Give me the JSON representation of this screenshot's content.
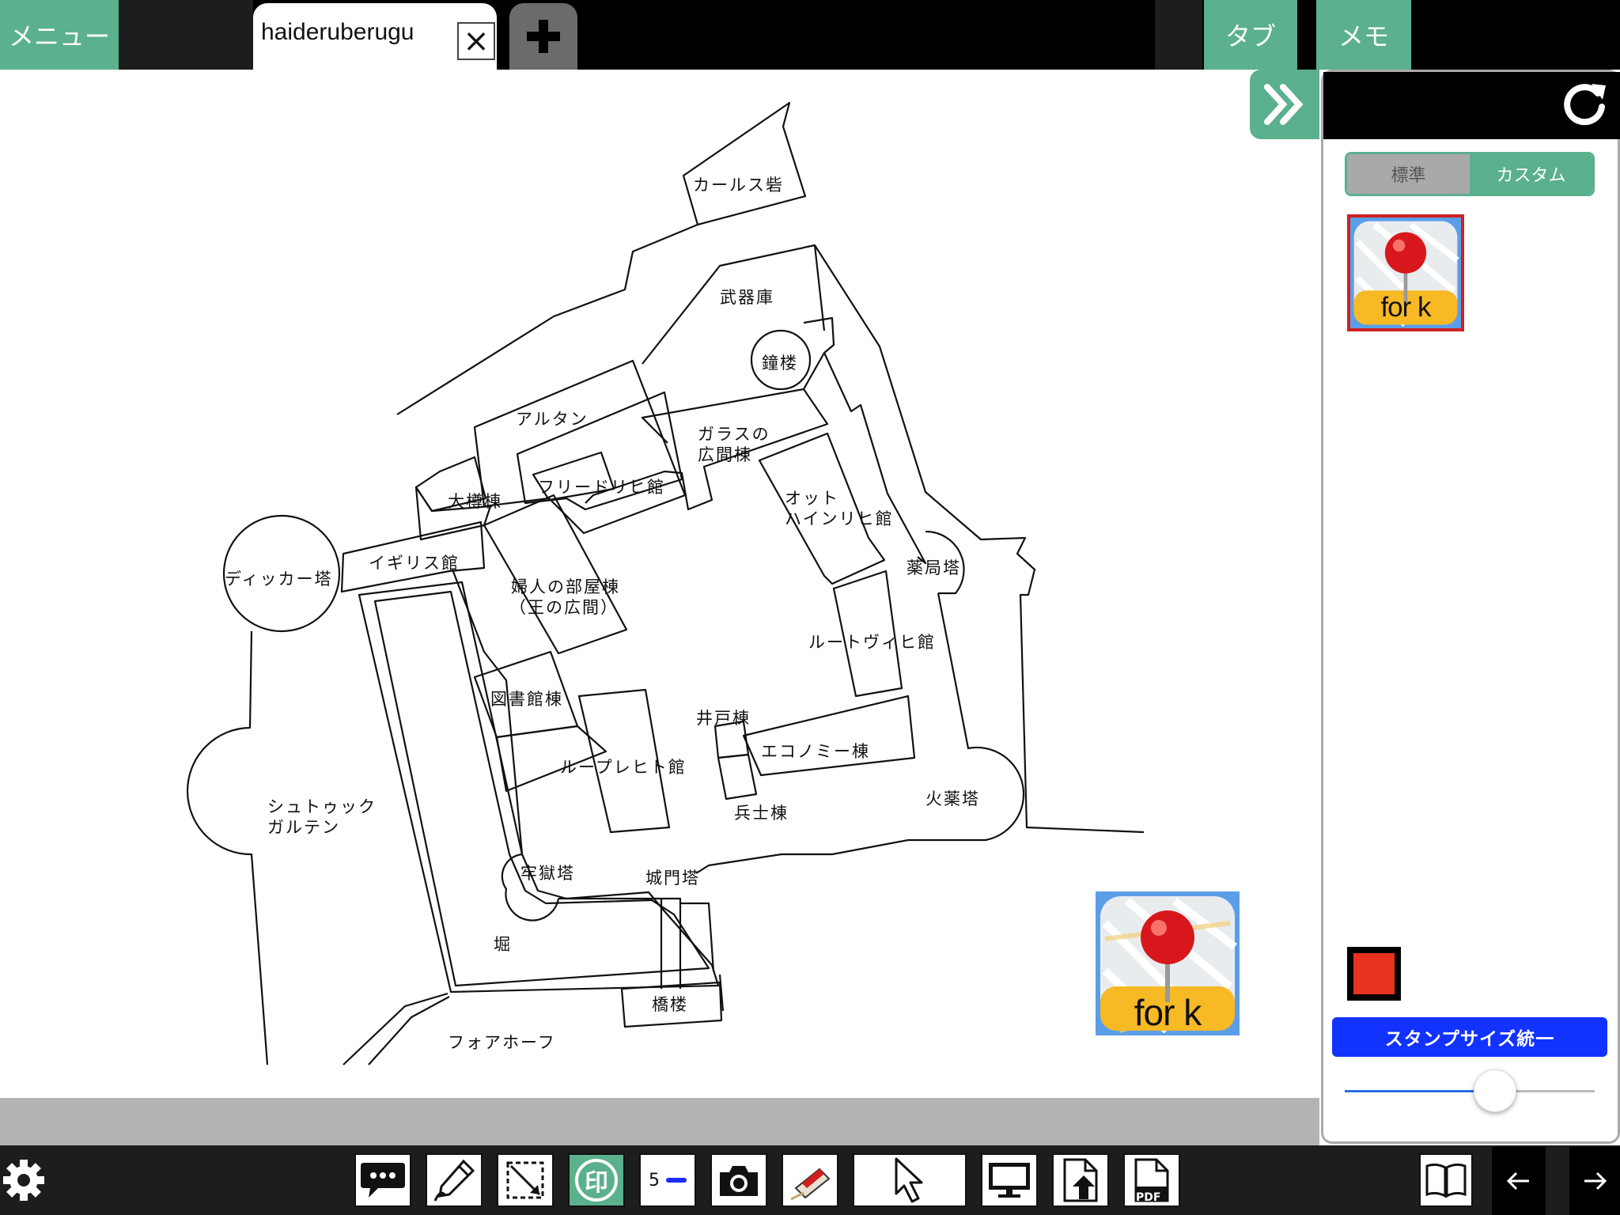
{
  "header": {
    "menu_label": "メニュー",
    "doc_tab_label": "haideruberugu",
    "close_tab_symbol": "×",
    "tabs_label": "タブ",
    "memo_label": "メモ"
  },
  "map": {
    "labels": {
      "carls": "カールス砦",
      "armory": "武器庫",
      "bell": "鐘楼",
      "arutan": "アルタン",
      "glass1": "ガラスの",
      "glass2": "広間棟",
      "friedrich": "フリードリヒ館",
      "barrel": "大樽棟",
      "otto1": "オット",
      "otto2": "ハインリヒ館",
      "dicker": "ディッカー塔",
      "english": "イギリス館",
      "ladies1": "婦人の部屋棟",
      "ladies2": "（王の広間）",
      "apothecary": "薬局塔",
      "ludwig": "ルートヴィヒ館",
      "library": "図書館棟",
      "well": "井戸棟",
      "economy": "エコノミー棟",
      "ruprecht": "ループレヒト館",
      "stuck1": "シュトゥック",
      "stuck2": "ガルテン",
      "soldier": "兵士棟",
      "powder": "火薬塔",
      "prison": "牢獄塔",
      "gate": "城門塔",
      "moat": "堀",
      "bridge": "橋楼",
      "forehof": "フォアホーフ"
    },
    "stamp_text": "for k"
  },
  "side_panel": {
    "segment": {
      "standard": "標準",
      "custom": "カスタム",
      "selected": "custom"
    },
    "stamp_text": "for k",
    "stamp_color": "#e8321e",
    "unify_label": "スタンプサイズ統一",
    "stamp_size_value": 0.6
  },
  "toolbar": {
    "line_width_value": "5",
    "line_color": "#1a2cff",
    "stamp_label": "印",
    "pdf_label": "PDF"
  },
  "colors": {
    "accent": "#5bb08e",
    "selected_border": "#d02020",
    "button_blue": "#1232ff"
  }
}
